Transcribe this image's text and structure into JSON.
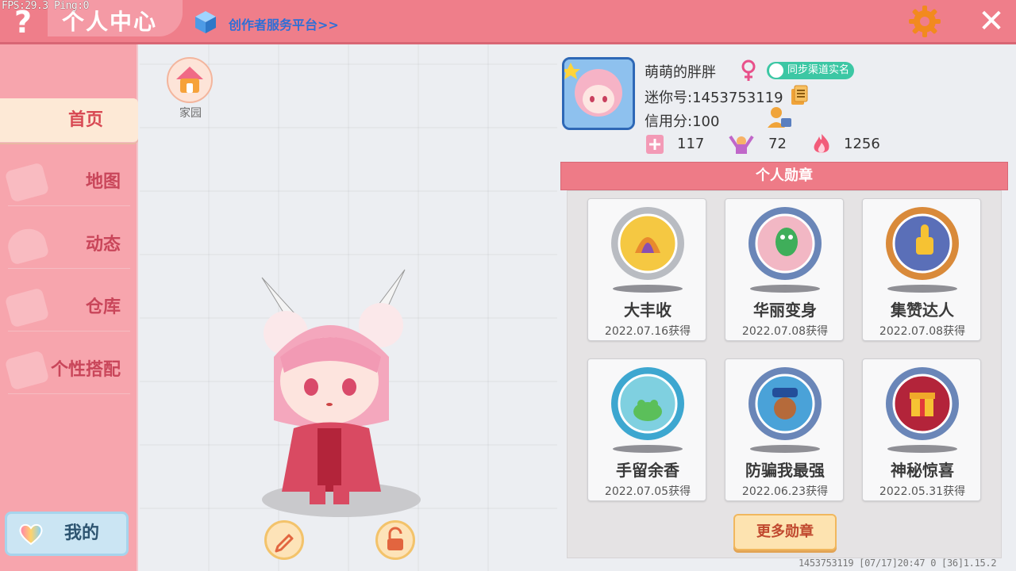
{
  "debug": {
    "fps_text": "FPS:29.3  Ping:0"
  },
  "header": {
    "title": "个人中心",
    "creator_link": "创作者服务平台>>",
    "help_icon": "question-icon",
    "settings_icon": "gear-icon",
    "close_icon": "close-icon"
  },
  "sidebar": {
    "items": [
      {
        "label": "首页",
        "active": true
      },
      {
        "label": "地图",
        "active": false
      },
      {
        "label": "动态",
        "active": false
      },
      {
        "label": "仓库",
        "active": false
      },
      {
        "label": "个性搭配",
        "active": false
      }
    ],
    "mine_button": "我的"
  },
  "stage": {
    "home_label": "家园"
  },
  "profile": {
    "nickname": "萌萌的胖胖",
    "gender": "female",
    "realname_badge": "同步渠道实名",
    "mini_id": "迷你号:1453753119",
    "credit": "信用分:100",
    "stats": [
      {
        "icon": "book-icon",
        "value": "117"
      },
      {
        "icon": "cheer-icon",
        "value": "72"
      },
      {
        "icon": "flame-icon",
        "value": "1256"
      }
    ]
  },
  "medals": {
    "header": "个人勋章",
    "items": [
      {
        "name": "大丰收",
        "date": "2022.07.16获得",
        "color": "#f5c842",
        "ring": "#b9bcc2"
      },
      {
        "name": "华丽变身",
        "date": "2022.07.08获得",
        "color": "#f2b7c4",
        "ring": "#6a86b8"
      },
      {
        "name": "集赞达人",
        "date": "2022.07.08获得",
        "color": "#5a6fb8",
        "ring": "#d98a3a"
      },
      {
        "name": "手留余香",
        "date": "2022.07.05获得",
        "color": "#7fd0e0",
        "ring": "#3da7d0"
      },
      {
        "name": "防骗我最强",
        "date": "2022.06.23获得",
        "color": "#4aa2d8",
        "ring": "#6a86b8"
      },
      {
        "name": "神秘惊喜",
        "date": "2022.05.31获得",
        "color": "#b3243a",
        "ring": "#6a86b8"
      }
    ],
    "more_button": "更多勋章"
  },
  "footer": {
    "info": "1453753119   [07/17]20:47 0  [36]1.15.2"
  }
}
